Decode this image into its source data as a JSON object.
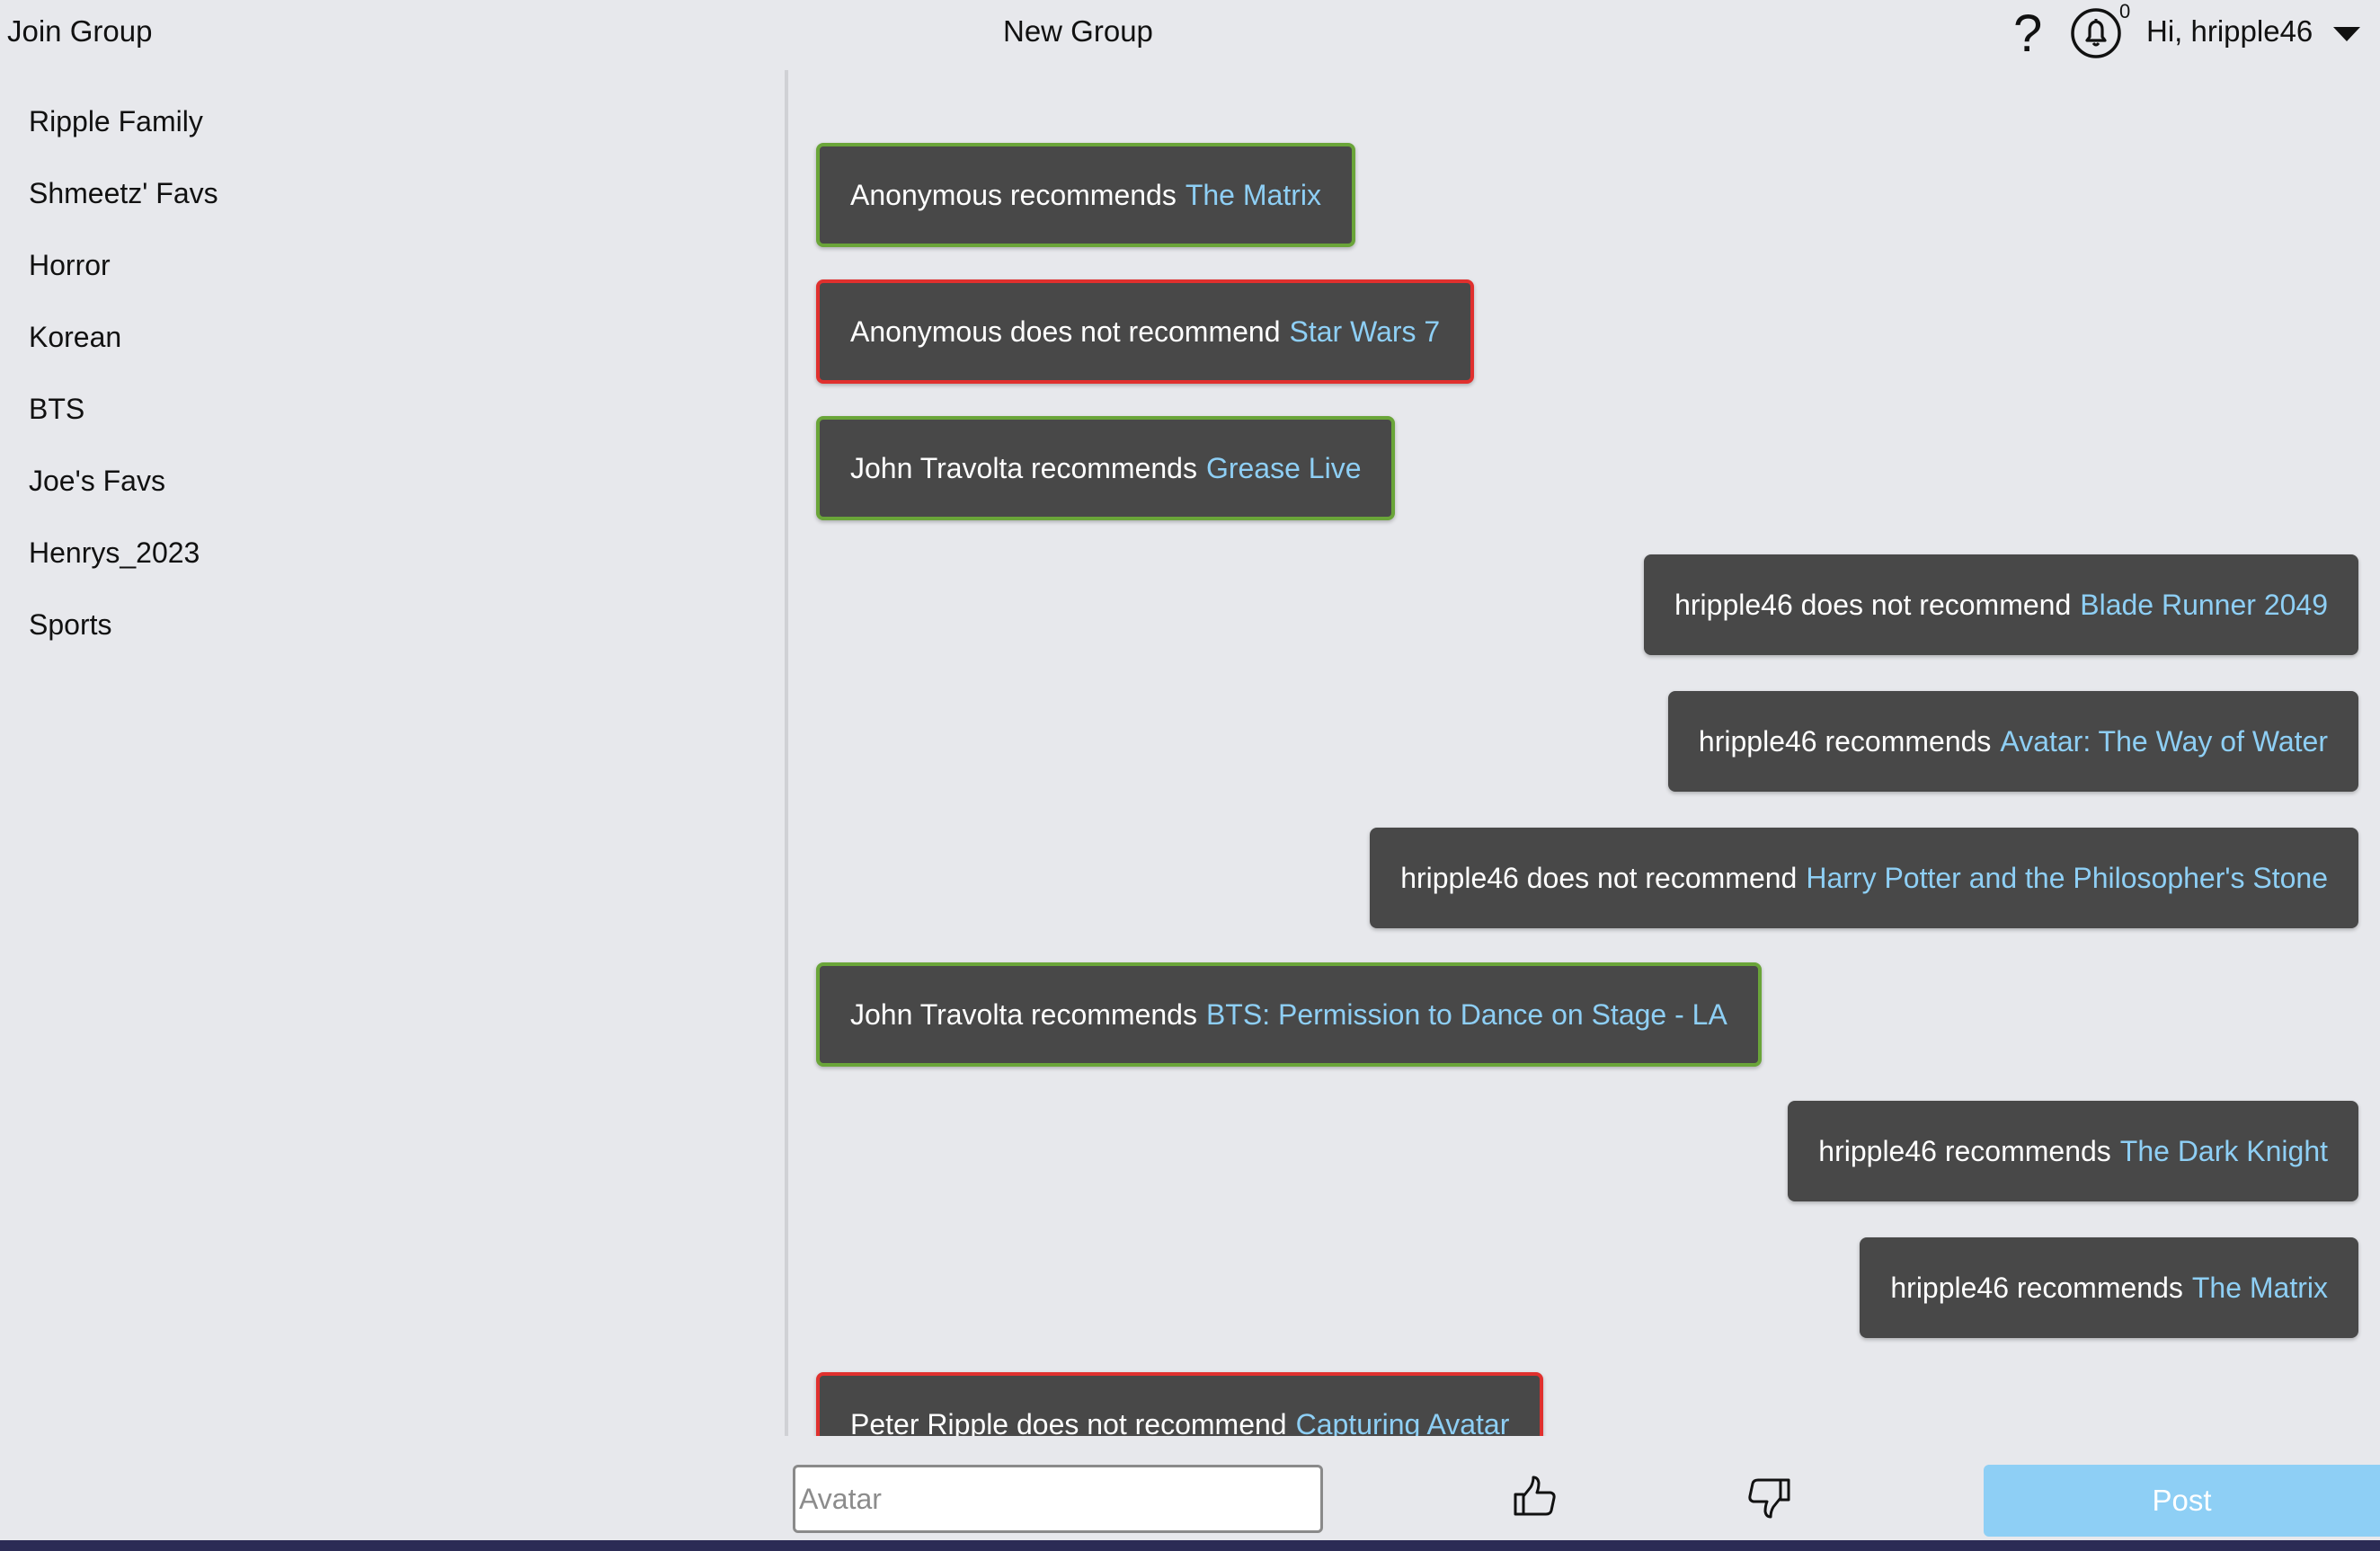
{
  "header": {
    "join_group": "Join Group",
    "new_group": "New Group",
    "help_symbol": "?",
    "notifications_count": "0",
    "greeting": "Hi, hripple46"
  },
  "sidebar": {
    "groups": [
      "Ripple Family",
      "Shmeetz' Favs",
      "Horror",
      "Korean",
      "BTS",
      "Joe's Favs",
      "Henrys_2023",
      "Sports"
    ]
  },
  "feed": [
    {
      "text": "Anonymous recommends",
      "movie": "The Matrix",
      "type": "recommend",
      "own": false
    },
    {
      "text": "Anonymous does not recommend",
      "movie": "Star Wars 7",
      "type": "not-recommend",
      "own": false
    },
    {
      "text": "John Travolta recommends",
      "movie": "Grease Live",
      "type": "recommend",
      "own": false
    },
    {
      "text": "hripple46 does not recommend",
      "movie": "Blade Runner 2049",
      "type": "not-recommend",
      "own": true
    },
    {
      "text": "hripple46 recommends",
      "movie": "Avatar: The Way of Water",
      "type": "recommend",
      "own": true
    },
    {
      "text": "hripple46 does not recommend",
      "movie": "Harry Potter and the Philosopher's Stone",
      "type": "not-recommend",
      "own": true
    },
    {
      "text": "John Travolta recommends",
      "movie": "BTS: Permission to Dance on Stage - LA",
      "type": "recommend",
      "own": false
    },
    {
      "text": "hripple46 recommends",
      "movie": "The Dark Knight",
      "type": "recommend",
      "own": true
    },
    {
      "text": "hripple46 recommends",
      "movie": "The Matrix",
      "type": "recommend",
      "own": true
    },
    {
      "text": "Peter Ripple does not recommend",
      "movie": "Capturing Avatar",
      "type": "not-recommend",
      "own": false
    }
  ],
  "composer": {
    "input_value": "",
    "input_placeholder": "Avatar",
    "post_label": "Post"
  },
  "colors": {
    "background": "#e7e8ec",
    "card": "#484848",
    "recommend_border": "#6aa539",
    "not_recommend_border": "#e0302e",
    "movie_link": "#8ecff5",
    "post_button": "#8ecff5"
  },
  "icons": [
    "help-icon",
    "bell-icon",
    "caret-down-icon",
    "thumbs-up-icon",
    "thumbs-down-icon"
  ]
}
